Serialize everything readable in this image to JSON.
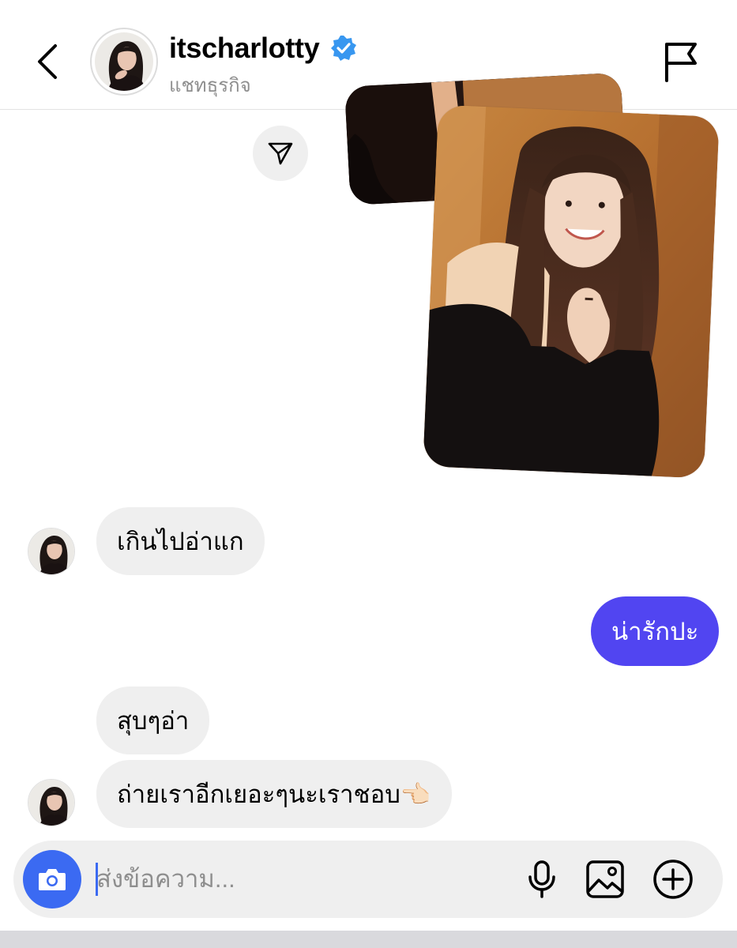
{
  "header": {
    "username": "itscharlotty",
    "subtitle": "แชทธุรกิจ",
    "verified": true
  },
  "icons": {
    "back": "chevron-left-icon",
    "verified": "verified-badge-icon",
    "flag": "flag-icon",
    "share": "paper-plane-icon",
    "camera": "camera-icon",
    "mic": "microphone-icon",
    "gallery": "image-icon",
    "more": "plus-circle-icon"
  },
  "messages": [
    {
      "side": "in",
      "text": "เกินไปอ่าแก"
    },
    {
      "side": "out",
      "text": "น่ารักปะ"
    },
    {
      "side": "in",
      "text": "สุบๆอ่า"
    },
    {
      "side": "in",
      "text": "ถ่ายเราอีกเยอะๆนะเราชอบ👈🏻"
    }
  ],
  "composer": {
    "placeholder": "ส่งข้อความ..."
  },
  "colors": {
    "outgoing_bubble": "#5145f1",
    "incoming_bubble": "#efefef",
    "camera_button": "#3b6af2",
    "verified_badge": "#3897f0",
    "subtitle_text": "#8e8e8e"
  }
}
